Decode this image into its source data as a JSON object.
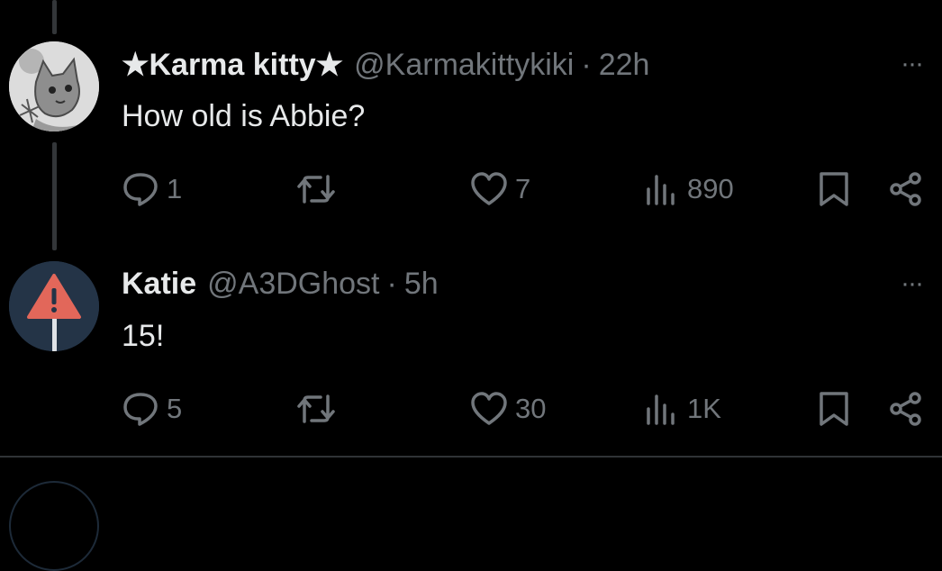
{
  "tweets": [
    {
      "name": "★Karma kitty★",
      "handle": "@Karmakittykiki",
      "separator": "·",
      "time": "22h",
      "text": "How old is Abbie?",
      "more": "···",
      "reply_count": "1",
      "repost_count": "",
      "like_count": "7",
      "view_count": "890"
    },
    {
      "name": "Katie",
      "handle": "@A3DGhost",
      "separator": "·",
      "time": "5h",
      "text": "15!",
      "more": "···",
      "reply_count": "5",
      "repost_count": "",
      "like_count": "30",
      "view_count": "1K"
    }
  ],
  "colors": {
    "background": "#000000",
    "text": "#e7e9ea",
    "muted": "#71767b",
    "warning_red": "#e2675a",
    "avatar_navy": "#243447"
  }
}
